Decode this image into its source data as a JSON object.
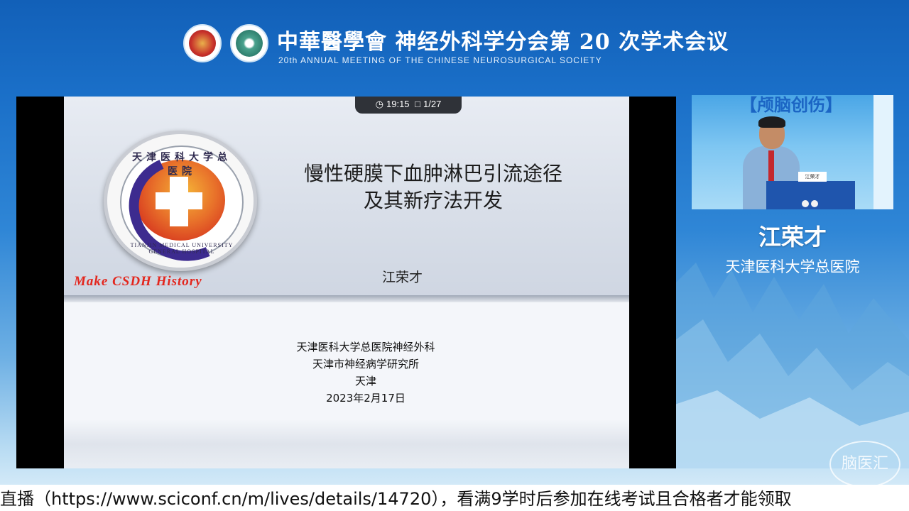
{
  "header": {
    "title_cn": "中華醫學會 神经外科学分会第 20 次学术会议",
    "title_en": "20th ANNUAL MEETING OF THE CHINESE NEUROSURGICAL SOCIETY",
    "logo1_name": "chinese-medical-association-logo",
    "logo2_name": "neurosurgical-society-logo"
  },
  "slide": {
    "timer": "19:15",
    "page": "1/27",
    "hospital_seal_top": "天津医科大学总医院",
    "hospital_seal_bottom": "TIANJIN MEDICAL UNIVERSITY GENERAL HOSPITAL",
    "tagline": "Make CSDH History",
    "title_line1": "慢性硬膜下血肿淋巴引流途径",
    "title_line2": "及其新疗法开发",
    "author": "江荣才",
    "affiliations": [
      "天津医科大学总医院神经外科",
      "天津市神经病学研究所",
      "天津",
      "2023年2月17日"
    ]
  },
  "speaker": {
    "banner": "【颅脑创伤】",
    "name": "江荣才",
    "organization": "天津医科大学总医院",
    "podium_card": "江荣才"
  },
  "watermark": "脑医汇",
  "ticker": "直播（https://www.sciconf.cn/m/lives/details/14720），看满9学时后参加在线考试且合格者才能领取"
}
